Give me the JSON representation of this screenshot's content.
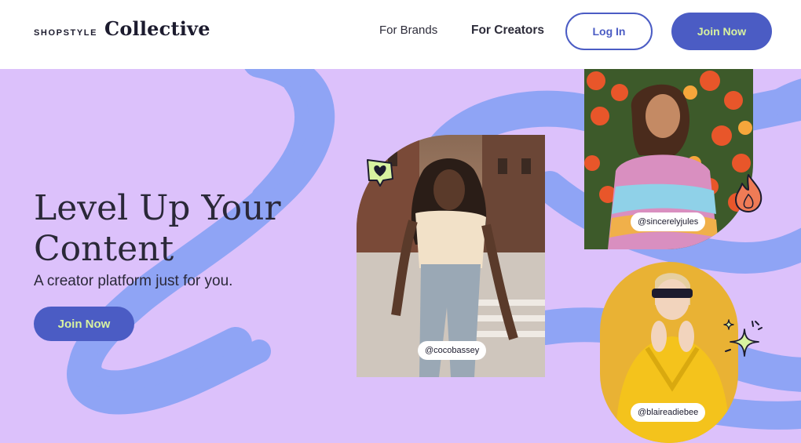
{
  "header": {
    "logo_small": "SHOPSTYLE",
    "logo_big": "Collective",
    "nav": {
      "for_brands": "For Brands",
      "for_creators": "For Creators"
    },
    "login_label": "Log In",
    "join_label": "Join Now"
  },
  "hero": {
    "title": "Level Up Your Content",
    "subtitle": "A creator platform just for you.",
    "join_label": "Join Now",
    "creators": [
      {
        "handle": "@cocobassey"
      },
      {
        "handle": "@sincerelyjules"
      },
      {
        "handle": "@blaireadiebee"
      }
    ]
  },
  "colors": {
    "accent": "#4b5cc4",
    "button_text": "#d8f2a0",
    "hero_bg": "#dcc1fb",
    "swirl": "#8fa4f5"
  },
  "icons": [
    "heart-bubble-icon",
    "flame-icon",
    "sparkle-icon"
  ]
}
